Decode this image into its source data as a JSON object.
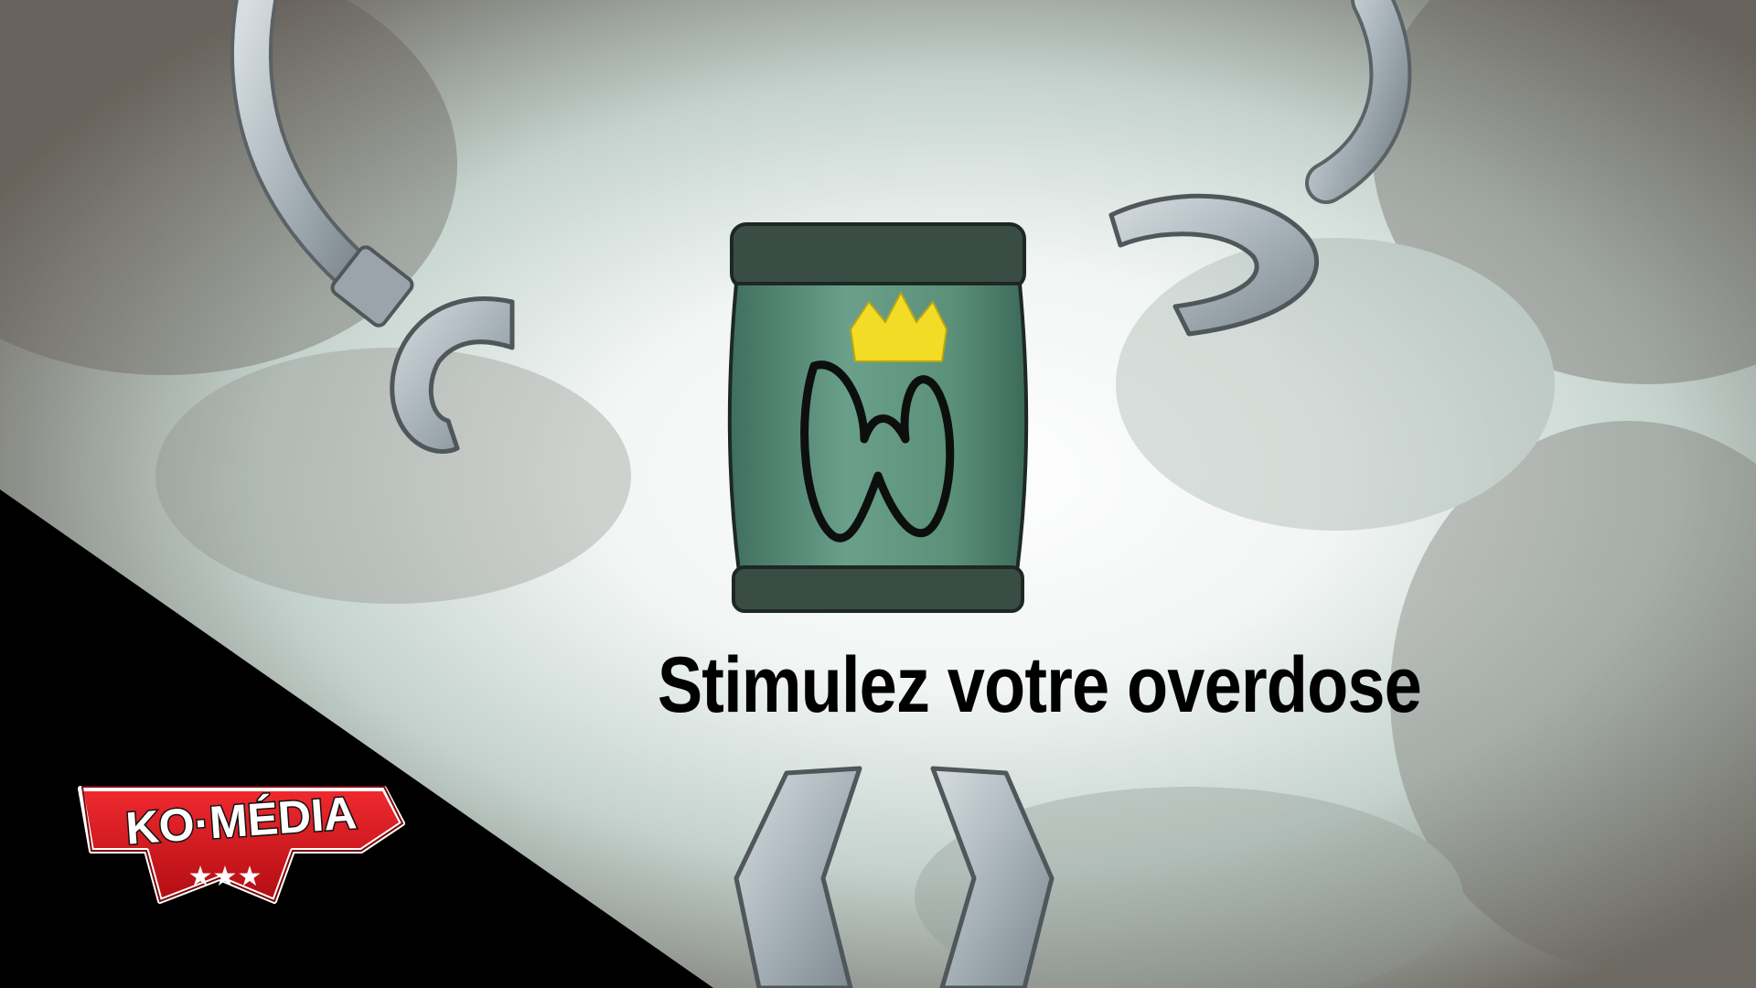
{
  "caption": {
    "text": "Stimulez votre overdose"
  },
  "logo": {
    "text": "KO·MÉDIA",
    "stars": "★★★"
  },
  "colors": {
    "corner_black": "#000000",
    "logo_red": "#d9141b",
    "logo_white": "#ffffff",
    "can_green": "#5c8f7c",
    "can_cap": "#3a4d45",
    "crown_yellow": "#f2dc25",
    "claw_grey": "#a8b2b8",
    "caption_color": "#000000"
  },
  "icons": {
    "can": "energy-can-icon",
    "crown": "crown-icon",
    "w_mark": "w-letter-icon"
  }
}
